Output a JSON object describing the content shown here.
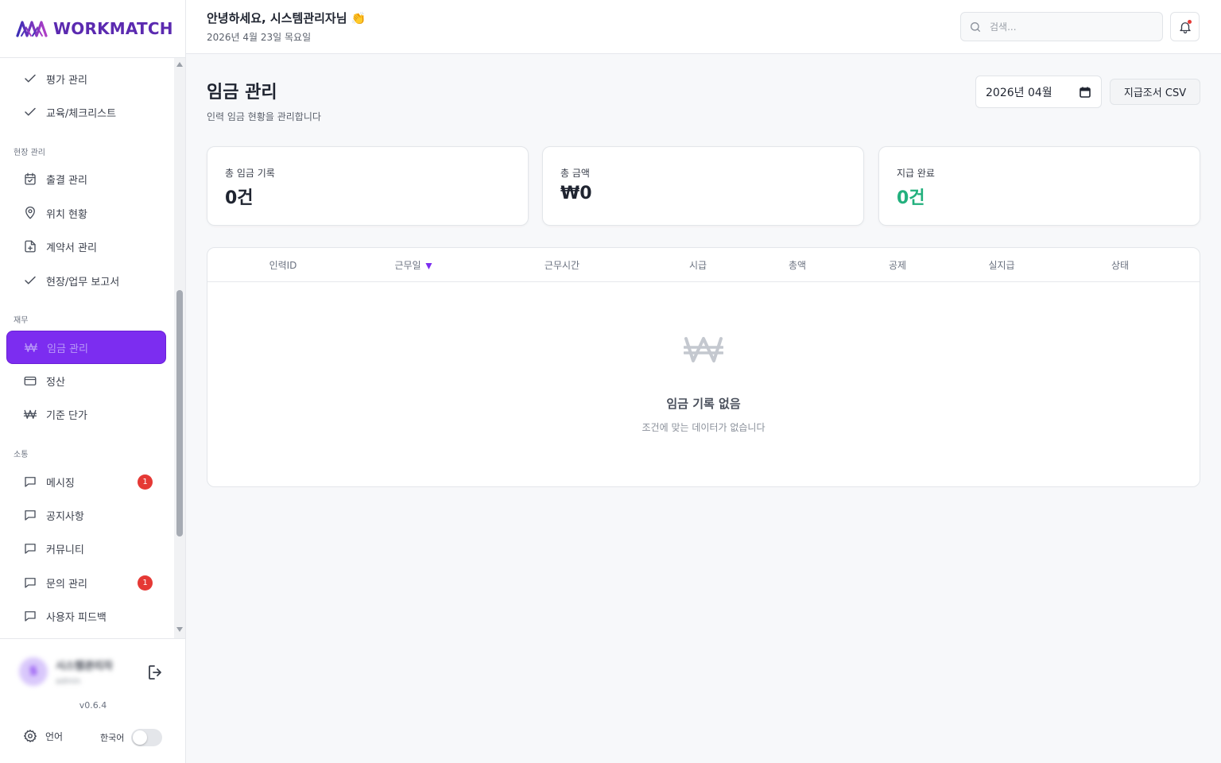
{
  "brand": {
    "name": "WORKMATCH",
    "color": "#5b2ab0"
  },
  "accent_color": "#7c2df0",
  "header": {
    "greeting": "안녕하세요, 시스템관리자님 👏",
    "date": "2026년 4월 23일 목요일",
    "search_placeholder": "검색...",
    "notification_icon": "bell-icon"
  },
  "sidebar": {
    "items_top": [
      {
        "label": "평가 관리",
        "icon": "check-icon"
      },
      {
        "label": "교육/체크리스트",
        "icon": "check-icon"
      }
    ],
    "sections": [
      {
        "title": "현장 관리",
        "items": [
          {
            "label": "출결 관리",
            "icon": "calendar-icon"
          },
          {
            "label": "위치 현황",
            "icon": "map-pin-icon"
          },
          {
            "label": "계약서 관리",
            "icon": "file-plus-icon"
          },
          {
            "label": "현장/업무 보고서",
            "icon": "check-icon"
          }
        ]
      },
      {
        "title": "재무",
        "items": [
          {
            "label": "임금 관리",
            "icon": "won-icon",
            "active": true
          },
          {
            "label": "정산",
            "icon": "credit-card-icon"
          },
          {
            "label": "기준 단가",
            "icon": "won-icon"
          }
        ]
      },
      {
        "title": "소통",
        "items": [
          {
            "label": "메시징",
            "icon": "message-icon",
            "badge": "1"
          },
          {
            "label": "공지사항",
            "icon": "message-icon"
          },
          {
            "label": "커뮤니티",
            "icon": "message-icon"
          },
          {
            "label": "문의 관리",
            "icon": "message-icon",
            "badge": "1"
          },
          {
            "label": "사용자 피드백",
            "icon": "message-icon"
          }
        ]
      }
    ],
    "user": {
      "avatar": "S",
      "name": "시스템관리자",
      "role": "admin"
    },
    "version": "v0.6.4",
    "settings_label": "언어",
    "language_label": "한국어",
    "language_toggle_on": false
  },
  "page": {
    "title": "임금 관리",
    "subtitle": "인력 임금 현황을 관리합니다",
    "month_value": "2026년 04월",
    "csv_button": "지급조서 CSV"
  },
  "stats": [
    {
      "label": "총 임금 기록",
      "value": "0건"
    },
    {
      "label": "총 금액",
      "value": "₩0"
    },
    {
      "label": "지급 완료",
      "value": "0건",
      "color": "#22b07d"
    }
  ],
  "table": {
    "columns": [
      "인력ID",
      "근무일",
      "근무시간",
      "시급",
      "총액",
      "공제",
      "실지급",
      "상태"
    ],
    "sort_column": "근무일",
    "sort_direction": "desc",
    "rows": [],
    "empty_title": "임금 기록 없음",
    "empty_subtitle": "조건에 맞는 데이터가 없습니다"
  }
}
